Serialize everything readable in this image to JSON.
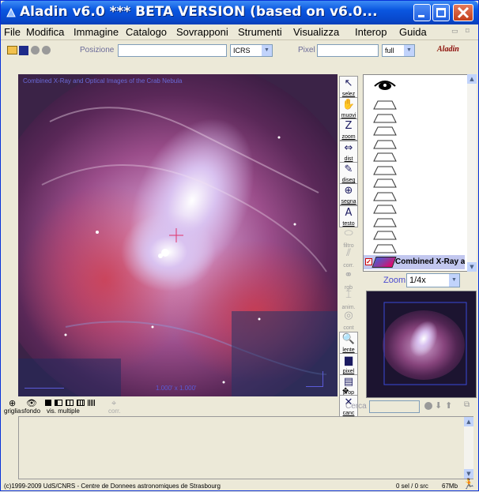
{
  "window": {
    "title": "Aladin v6.0    *** BETA VERSION (based on v6.0...",
    "controls": {
      "minimize_icon": "minimize-icon",
      "maximize_icon": "maximize-icon",
      "close_icon": "close-icon"
    }
  },
  "menu": [
    "File",
    "Modifica",
    "Immagine",
    "Catalogo",
    "Sovrapponi",
    "Strumenti",
    "Visualizza",
    "Interop",
    "Guida"
  ],
  "toolbar": {
    "position_label": "Posizione",
    "position_value": "",
    "frame_value": "ICRS",
    "pixel_label": "Pixel",
    "pixel_value": "",
    "pixel_mode": "full",
    "logo_text": "Aladin"
  },
  "view": {
    "caption": "Combined X-Ray and Optical Images of the Crab Nebula",
    "footer": "1.000' x 1.000'"
  },
  "tools": [
    {
      "label": "selez",
      "icon": "select-arrow-icon",
      "enabled": true
    },
    {
      "label": "muovi",
      "icon": "hand-icon",
      "enabled": true
    },
    {
      "label": "zoom",
      "icon": "zoom-icon",
      "enabled": true
    },
    {
      "label": "dist",
      "icon": "distance-icon",
      "enabled": true
    },
    {
      "label": "diseg",
      "icon": "pencil-icon",
      "enabled": true
    },
    {
      "label": "segna",
      "icon": "target-icon",
      "enabled": true
    },
    {
      "label": "testo",
      "icon": "text-icon",
      "enabled": true
    },
    {
      "label": "filtro",
      "icon": "filter-icon",
      "enabled": false
    },
    {
      "label": "corr.",
      "icon": "correct-icon",
      "enabled": false
    },
    {
      "label": "rgb",
      "icon": "rgb-icon",
      "enabled": false
    },
    {
      "label": "anim.",
      "icon": "animate-icon",
      "enabled": false
    },
    {
      "label": "cont",
      "icon": "contour-icon",
      "enabled": false
    },
    {
      "label": "lente",
      "icon": "magnifier-icon",
      "enabled": true
    },
    {
      "label": "pixel",
      "icon": "pixel-icon",
      "enabled": true
    },
    {
      "label": "prop",
      "icon": "properties-icon",
      "enabled": true
    },
    {
      "label": "canc",
      "icon": "delete-icon",
      "enabled": true
    }
  ],
  "layers": {
    "eye_icon": "eye-icon",
    "active_layer": "Combined X-Ray a"
  },
  "zoom": {
    "label": "Zoom",
    "value": "1/4x"
  },
  "bottom": {
    "grid_label": "griglia",
    "bg_label": "sfondo",
    "multi_label": "vis. multiple",
    "corr_label": "corr.",
    "search_label": "Cerca",
    "search_value": ""
  },
  "console_text": "",
  "status": {
    "copyright": "(c)1999-2009 UdS/CNRS - Centre de Donnees astronomiques de Strasbourg",
    "selection": "0 sel / 0 src",
    "memory": "67Mb"
  }
}
